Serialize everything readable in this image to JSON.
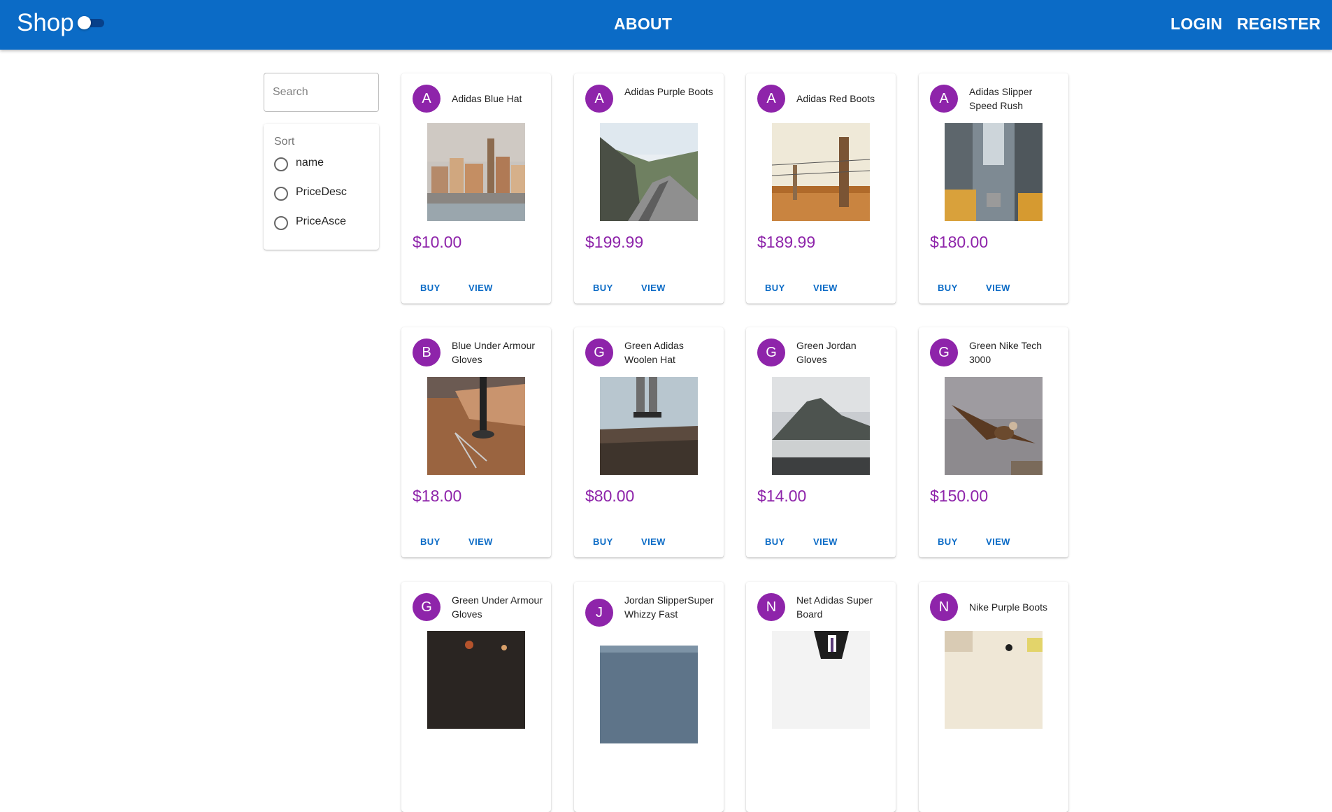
{
  "header": {
    "brand": "Shop",
    "about": "ABOUT",
    "login": "LOGIN",
    "register": "REGISTER",
    "theme_toggle": "off",
    "color": "#0B6BC6"
  },
  "sidebar": {
    "search_placeholder": "Search",
    "sort_label": "Sort",
    "sort_options": [
      "name",
      "PriceDesc",
      "PriceAsce"
    ]
  },
  "buttons": {
    "buy": "BUY",
    "view": "VIEW"
  },
  "products": [
    {
      "initial": "A",
      "name": "Adidas Blue Hat",
      "price": "$10.00",
      "image": "city-buildings-photo"
    },
    {
      "initial": "A",
      "name": "Adidas Purple Boots",
      "price": "$199.99",
      "image": "mountain-road-photo"
    },
    {
      "initial": "A",
      "name": "Adidas Red Boots",
      "price": "$189.99",
      "image": "fence-post-photo"
    },
    {
      "initial": "A",
      "name": "Adidas Slipper Speed Rush",
      "price": "$180.00",
      "image": "city-taxis-photo"
    },
    {
      "initial": "B",
      "name": "Blue Under Armour Gloves",
      "price": "$18.00",
      "image": "desk-compass-photo"
    },
    {
      "initial": "G",
      "name": "Green Adidas Woolen Hat",
      "price": "$80.00",
      "image": "cliff-edge-photo"
    },
    {
      "initial": "G",
      "name": "Green Jordan Gloves",
      "price": "$14.00",
      "image": "mountain-fog-photo"
    },
    {
      "initial": "G",
      "name": "Green Nike Tech 3000",
      "price": "$150.00",
      "image": "eagle-photo"
    },
    {
      "initial": "G",
      "name": "Green Under Armour Gloves",
      "price": "",
      "image": "dark-lights-photo"
    },
    {
      "initial": "J",
      "name": "Jordan SlipperSuper Whizzy Fast",
      "price": "",
      "image": "sky-landscape-photo"
    },
    {
      "initial": "N",
      "name": "Net Adidas Super Board",
      "price": "",
      "image": "person-suit-photo"
    },
    {
      "initial": "N",
      "name": "Nike Purple Boots",
      "price": "",
      "image": "bright-scene-photo"
    }
  ]
}
